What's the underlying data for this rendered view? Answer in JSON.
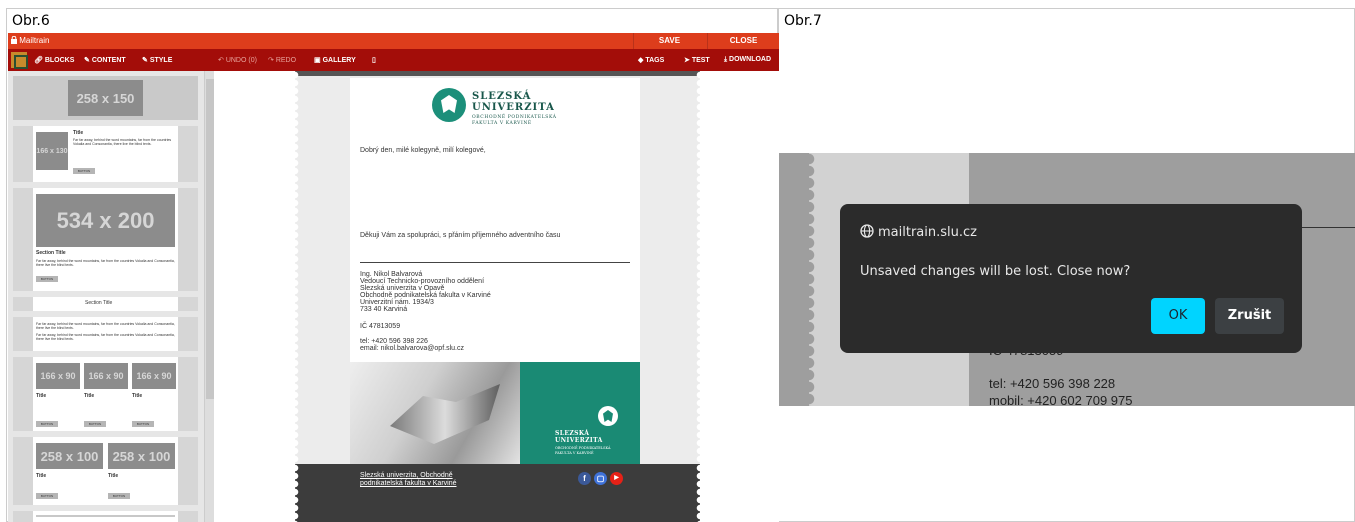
{
  "figures": {
    "left_label": "Obr.6",
    "right_label": "Obr.7"
  },
  "app": {
    "title": "Mailtrain",
    "save": "SAVE",
    "close": "CLOSE",
    "toolbar": {
      "blocks": "BLOCKS",
      "content": "CONTENT",
      "style": "STYLE",
      "undo": "UNDO (0)",
      "redo": "REDO",
      "gallery": "GALLERY",
      "tags": "TAGS",
      "test": "TEST",
      "download": "DOWNLOAD"
    }
  },
  "blocks_panel": {
    "ph_258x150": "258 x 150",
    "ph_166x130": "166 x 130",
    "ph_534x200": "534 x 200",
    "ph_166x90": "166 x 90",
    "ph_258x100": "258 x 100",
    "title": "Title",
    "section_title": "Section Title",
    "lorem": "Far far away, behind the word mountains, far from the countries Vokalia and Consonantia, there live the blind texts.",
    "button": "BUTTON"
  },
  "email": {
    "uni_name_1": "SLEZSKÁ",
    "uni_name_2": "UNIVERZITA",
    "uni_sub_1": "OBCHODNĚ PODNIKATELSKÁ",
    "uni_sub_2": "FAKULTA V KARVINÉ",
    "greeting": "Dobrý den, milé kolegyně, milí kolegové,",
    "thanks": "Děkuji Vám za spolupráci, s přáním příjemného adventního času",
    "sig_name": "Ing. Nikol Balvarová",
    "sig_dept": "Vedoucí Technicko-provozního oddělení",
    "sig_uni": "Slezská univerzita v Opavě",
    "sig_fac": "Obchodně podnikatelská fakulta v Karviné",
    "sig_addr1": "Univerzitní nám. 1934/3",
    "sig_addr2": "733 40 Karviná",
    "ic": "IČ 47813059",
    "tel": "tel: +420 596 398 226",
    "email": "email: nikol.balvarova@opf.slu.cz",
    "banner_name_1": "SLEZSKÁ",
    "banner_name_2": "UNIVERZITA",
    "banner_sub_1": "OBCHODNĚ PODNIKATELSKÁ",
    "banner_sub_2": "FAKULTA V KARVINÉ",
    "footer_link_1": "Slezská univerzita, Obchodně",
    "footer_link_2": "podnikatelská fakulta v Karviné"
  },
  "dialog": {
    "origin": "mailtrain.slu.cz",
    "message": "Unsaved changes will be lost. Close now?",
    "ok": "OK",
    "cancel": "Zrušit",
    "behind_ic": "IČ 47813059",
    "behind_tel": "tel: +420 596 398 228",
    "behind_mobil": "mobil: +420 602 709 975"
  },
  "colors": {
    "titlebar": "#dd3d1c",
    "toolbar": "#a30d09",
    "brand_green": "#1a8a74",
    "ok_button": "#00d4ff"
  }
}
